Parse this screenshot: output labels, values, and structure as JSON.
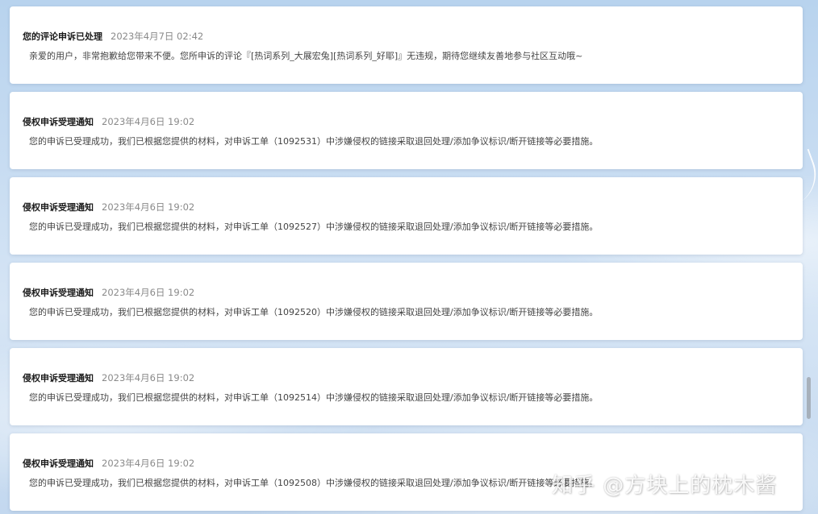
{
  "notifications": [
    {
      "title": "您的评论申诉已处理",
      "time": "2023年4月7日 02:42",
      "body": "亲爱的用户，非常抱歉给您带来不便。您所申诉的评论『[热词系列_大展宏兔][热词系列_好耶]』无违规，期待您继续友善地参与社区互动哦~"
    },
    {
      "title": "侵权申诉受理通知",
      "time": "2023年4月6日 19:02",
      "body": "您的申诉已受理成功，我们已根据您提供的材料，对申诉工单（1092531）中涉嫌侵权的链接采取退回处理/添加争议标识/断开链接等必要措施。"
    },
    {
      "title": "侵权申诉受理通知",
      "time": "2023年4月6日 19:02",
      "body": "您的申诉已受理成功，我们已根据您提供的材料，对申诉工单（1092527）中涉嫌侵权的链接采取退回处理/添加争议标识/断开链接等必要措施。"
    },
    {
      "title": "侵权申诉受理通知",
      "time": "2023年4月6日 19:02",
      "body": "您的申诉已受理成功，我们已根据您提供的材料，对申诉工单（1092520）中涉嫌侵权的链接采取退回处理/添加争议标识/断开链接等必要措施。"
    },
    {
      "title": "侵权申诉受理通知",
      "time": "2023年4月6日 19:02",
      "body": "您的申诉已受理成功，我们已根据您提供的材料，对申诉工单（1092514）中涉嫌侵权的链接采取退回处理/添加争议标识/断开链接等必要措施。"
    },
    {
      "title": "侵权申诉受理通知",
      "time": "2023年4月6日 19:02",
      "body": "您的申诉已受理成功，我们已根据您提供的材料，对申诉工单（1092508）中涉嫌侵权的链接采取退回处理/添加争议标识/断开链接等必要措施。"
    }
  ],
  "watermark": "知乎 @方块上的枕木酱",
  "colors": {
    "card_background": "#ffffff",
    "title_text": "#1a1a1a",
    "time_text": "#8a8a8a",
    "body_text": "#444444",
    "page_background": "#c9ddf2"
  }
}
